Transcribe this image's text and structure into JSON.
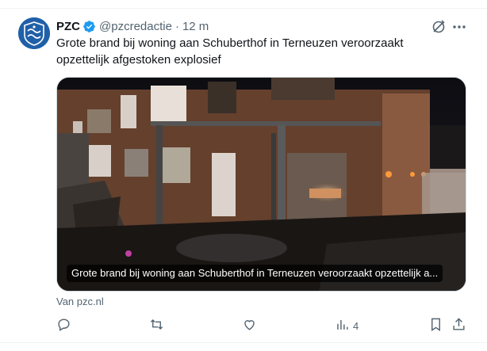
{
  "tweet": {
    "author_name": "PZC",
    "handle": "@pzcredactie",
    "separator": "·",
    "time": "12 m",
    "text": "Grote brand bij woning aan Schuberthof in Terneuzen veroorzaakt opzettelijk afgestoken explosief",
    "avatar_text": "PZC"
  },
  "card": {
    "caption": "Grote brand bij woning aan Schuberthof in Terneuzen veroorzaakt opzettelijk a...",
    "source": "Van pzc.nl"
  },
  "actions": {
    "reply_count": "",
    "repost_count": "",
    "like_count": "",
    "views_count": "4"
  },
  "colors": {
    "verified": "#1d9bf0",
    "secondary_text": "#536471",
    "avatar_bg": "#2060a8"
  },
  "icons": [
    "verified-badge-icon",
    "grok-icon",
    "more-icon",
    "reply-icon",
    "repost-icon",
    "like-icon",
    "views-icon",
    "bookmark-icon",
    "share-icon"
  ]
}
